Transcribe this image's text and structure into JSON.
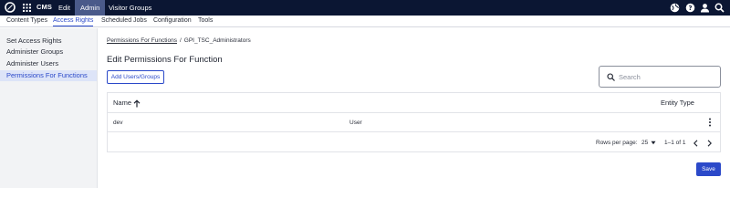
{
  "topbar": {
    "app_name": "CMS",
    "menus": [
      "Edit",
      "Admin",
      "Visitor Groups"
    ],
    "active_menu": "Admin",
    "right_icons": [
      "globe-icon",
      "help-icon",
      "user-icon",
      "search-icon"
    ]
  },
  "subnav": {
    "items": [
      "Content Types",
      "Access Rights",
      "Scheduled Jobs",
      "Configuration",
      "Tools"
    ],
    "active": "Access Rights"
  },
  "sidebar": {
    "items": [
      "Set Access Rights",
      "Administer Groups",
      "Administer Users",
      "Permissions For Functions"
    ],
    "active": "Permissions For Functions"
  },
  "breadcrumb": {
    "link": "Permissions For Functions",
    "separator": "/",
    "current": "GPI_TSC_Administrators"
  },
  "main": {
    "title": "Edit Permissions For Function",
    "add_button": "Add Users/Groups",
    "search_placeholder": "Search"
  },
  "table": {
    "columns": [
      "Name",
      "Entity Type"
    ],
    "rows": [
      {
        "name": "dev",
        "type": "User"
      }
    ],
    "rows_per_page_label": "Rows per page:",
    "rows_per_page": "25",
    "range": "1–1 of 1"
  },
  "actions": {
    "save": "Save"
  },
  "colors": {
    "topbar": "#0b1633",
    "accent": "#2b49c9",
    "sidebar_bg": "#f2f3f5",
    "sidebar_active": "#dde4f8"
  }
}
